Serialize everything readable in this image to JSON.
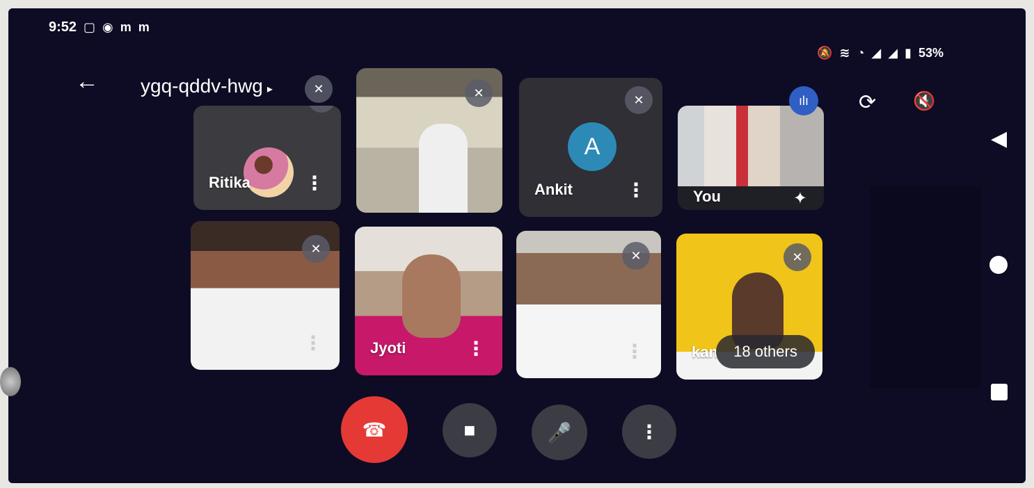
{
  "status_bar": {
    "time": "9:52",
    "left_icons": [
      "notification-icon",
      "compass-icon",
      "gmail-icon",
      "gmail-icon"
    ],
    "left_icon_glyphs": [
      "▢",
      "◉",
      "m",
      "m"
    ],
    "right_icons": [
      "silent-icon",
      "volte-icon",
      "wifi-icon",
      "signal-icon",
      "signal-icon",
      "battery-icon"
    ],
    "right_icon_glyphs": [
      "🔕",
      "≋",
      "◔",
      "◢",
      "◢",
      "▮"
    ],
    "battery": "53%"
  },
  "meeting": {
    "code": "ygq-qddv-hwg",
    "back_glyph": "←",
    "caret_glyph": "▸",
    "switch_camera_glyph": "⟳",
    "audio_off_glyph": "🔇"
  },
  "participants": [
    {
      "name": "Ritika",
      "muted": true
    },
    {
      "name": "",
      "muted": true
    },
    {
      "name": "Ankit",
      "muted": true,
      "initial": "A"
    },
    {
      "name": "You",
      "speaking": true
    },
    {
      "name": "",
      "muted": true
    },
    {
      "name": "Jyoti",
      "muted": false
    },
    {
      "name": "",
      "muted": true
    },
    {
      "name": "kan",
      "muted": true
    }
  ],
  "others_pill": "18 others",
  "controls": {
    "end_call_glyph": "☎",
    "camera_glyph": "■",
    "mic_glyph": "🎤",
    "more_glyph": "⋮"
  },
  "glyphs": {
    "more": "⋮",
    "muted": "✕",
    "speaking": "ılı",
    "sparkle": "✦"
  },
  "nav": {
    "back_glyph": "◀"
  },
  "colors": {
    "background": "#0d0c24",
    "end_call": "#e53935",
    "avatar": "#2d8ab7",
    "speaking": "#2f5ec4"
  }
}
